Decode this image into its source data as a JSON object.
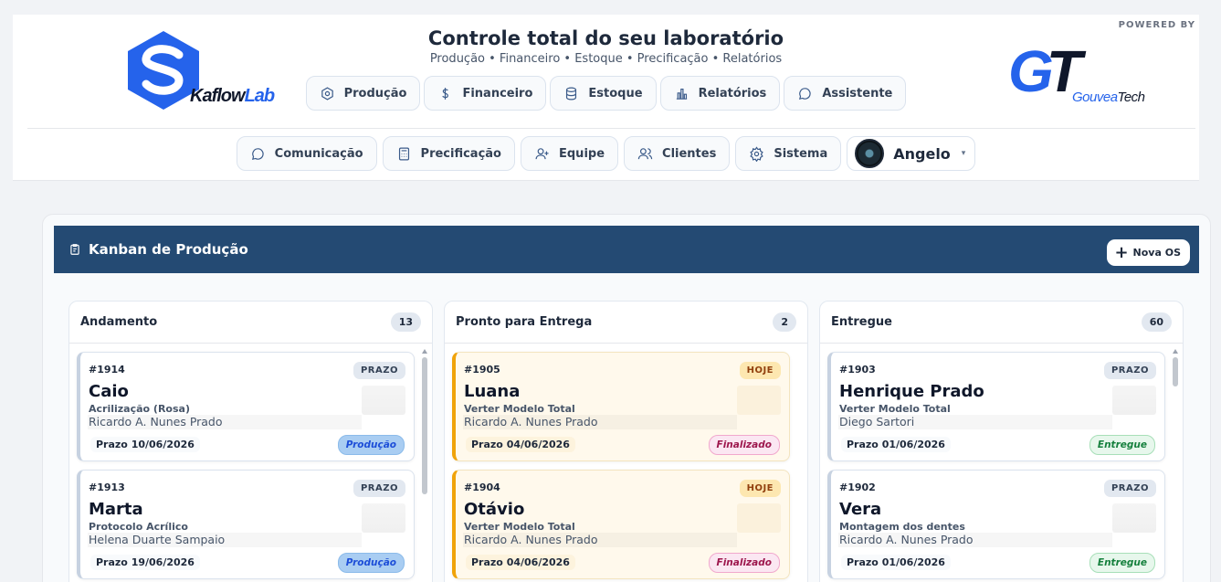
{
  "header": {
    "brand": {
      "name_a": "Kaflow",
      "name_b": "Lab"
    },
    "title": "Controle total do seu laboratório",
    "subtitle": "Produção • Financeiro • Estoque • Precificação • Relatórios",
    "powered_by": "POWERED BY",
    "partner": {
      "mark_a": "G",
      "mark_b": "T",
      "name_a": "Gouvea",
      "name_b": "Tech"
    },
    "nav_primary": [
      {
        "label": "Produção",
        "icon": "hexagon-gear-icon"
      },
      {
        "label": "Financeiro",
        "icon": "dollar-icon"
      },
      {
        "label": "Estoque",
        "icon": "database-icon"
      },
      {
        "label": "Relatórios",
        "icon": "bar-chart-icon"
      },
      {
        "label": "Assistente",
        "icon": "chat-bubble-icon"
      }
    ],
    "nav_secondary": [
      {
        "label": "Comunicação",
        "icon": "chat-bubble-icon"
      },
      {
        "label": "Precificação",
        "icon": "calculator-icon"
      },
      {
        "label": "Equipe",
        "icon": "user-plus-icon"
      },
      {
        "label": "Clientes",
        "icon": "users-icon"
      },
      {
        "label": "Sistema",
        "icon": "gear-icon"
      }
    ],
    "user": {
      "name": "Angelo",
      "caret": "▾"
    }
  },
  "kanban": {
    "title": "Kanban de Produção",
    "new_button": "Nova OS",
    "columns": [
      {
        "title": "Andamento",
        "count": "13",
        "cards": [
          {
            "id": "#1914",
            "badge": "PRAZO",
            "name": "Caio",
            "service": "Acrilização (Rosa)",
            "doctor": "Ricardo A. Nunes Prado",
            "deadline": "Prazo 10/06/2026",
            "status": "Produção"
          },
          {
            "id": "#1913",
            "badge": "PRAZO",
            "name": "Marta",
            "service": "Protocolo Acrílico",
            "doctor": "Helena Duarte Sampaio",
            "deadline": "Prazo 19/06/2026",
            "status": "Produção"
          }
        ]
      },
      {
        "title": "Pronto para Entrega",
        "count": "2",
        "cards": [
          {
            "id": "#1905",
            "badge": "HOJE",
            "name": "Luana",
            "service": "Verter Modelo Total",
            "doctor": "Ricardo A. Nunes Prado",
            "deadline": "Prazo 04/06/2026",
            "status": "Finalizado"
          },
          {
            "id": "#1904",
            "badge": "HOJE",
            "name": "Otávio",
            "service": "Verter Modelo Total",
            "doctor": "Ricardo A. Nunes Prado",
            "deadline": "Prazo 04/06/2026",
            "status": "Finalizado"
          }
        ]
      },
      {
        "title": "Entregue",
        "count": "60",
        "cards": [
          {
            "id": "#1903",
            "badge": "PRAZO",
            "name": "Henrique Prado",
            "service": "Verter Modelo Total",
            "doctor": "Diego Sartori",
            "deadline": "Prazo 01/06/2026",
            "status": "Entregue"
          },
          {
            "id": "#1902",
            "badge": "PRAZO",
            "name": "Vera",
            "service": "Montagem dos dentes",
            "doctor": "Ricardo A. Nunes Prado",
            "deadline": "Prazo 01/06/2026",
            "status": "Entregue"
          }
        ]
      }
    ]
  },
  "colors": {
    "header_bar": "#244a73",
    "accent": "#2563eb",
    "ready_border": "#f0a30a"
  }
}
